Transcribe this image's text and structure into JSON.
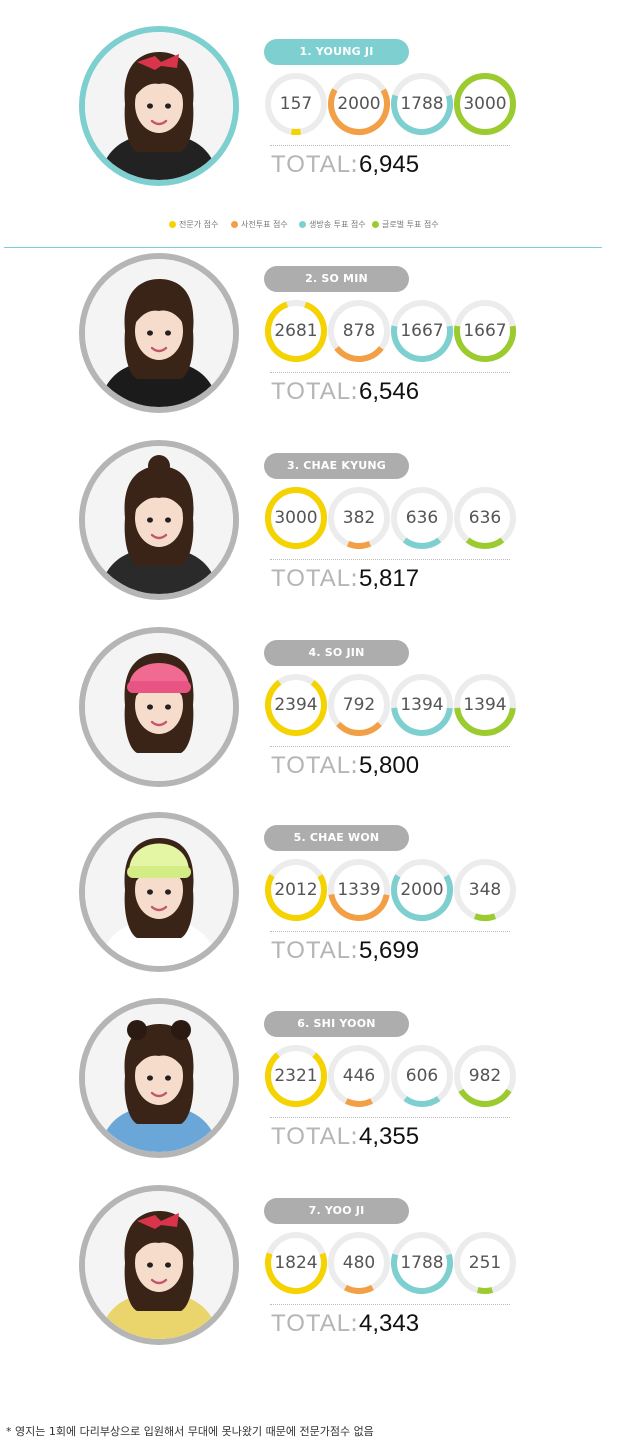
{
  "colors": {
    "expert": "#f5d300",
    "preliminary": "#f39f45",
    "live": "#7ecfcf",
    "global": "#9bcb2e",
    "ring_track": "#ececec",
    "first_accent": "#7ecfcf"
  },
  "legend": [
    {
      "key": "expert",
      "label": "전문가 점수"
    },
    {
      "key": "preliminary",
      "label": "사전투표 점수"
    },
    {
      "key": "live",
      "label": "생방송 투표 점수"
    },
    {
      "key": "global",
      "label": "글로벌 투표 점수"
    }
  ],
  "total_label": "TOTAL",
  "total_colon": ":",
  "max_score": 3000,
  "contestants": [
    {
      "rank_label": "1. YOUNG JI",
      "scores": [
        157,
        2000,
        1788,
        3000
      ],
      "total": "6,945",
      "photo_icon": "portrait-photo",
      "accessory": "red-bow"
    },
    {
      "rank_label": "2. SO MIN",
      "scores": [
        2681,
        878,
        1667,
        1667
      ],
      "total": "6,546",
      "photo_icon": "portrait-photo",
      "accessory": "none"
    },
    {
      "rank_label": "3. CHAE KYUNG",
      "scores": [
        3000,
        382,
        636,
        636
      ],
      "total": "5,817",
      "photo_icon": "portrait-photo",
      "accessory": "top-bun"
    },
    {
      "rank_label": "4. SO JIN",
      "scores": [
        2394,
        792,
        1394,
        1394
      ],
      "total": "5,800",
      "photo_icon": "portrait-photo",
      "accessory": "pink-beanie"
    },
    {
      "rank_label": "5. CHAE WON",
      "scores": [
        2012,
        1339,
        2000,
        348
      ],
      "total": "5,699",
      "photo_icon": "portrait-photo",
      "accessory": "lime-beanie"
    },
    {
      "rank_label": "6. SHI YOON",
      "scores": [
        2321,
        446,
        606,
        982
      ],
      "total": "4,355",
      "photo_icon": "portrait-photo",
      "accessory": "double-buns"
    },
    {
      "rank_label": "7. YOO JI",
      "scores": [
        1824,
        480,
        1788,
        251
      ],
      "total": "4,343",
      "photo_icon": "portrait-photo",
      "accessory": "red-bow"
    }
  ],
  "footnote": "* 영지는 1회에 다리부상으로 입원해서 무대에 못나왔기 때문에 전문가점수 없음"
}
